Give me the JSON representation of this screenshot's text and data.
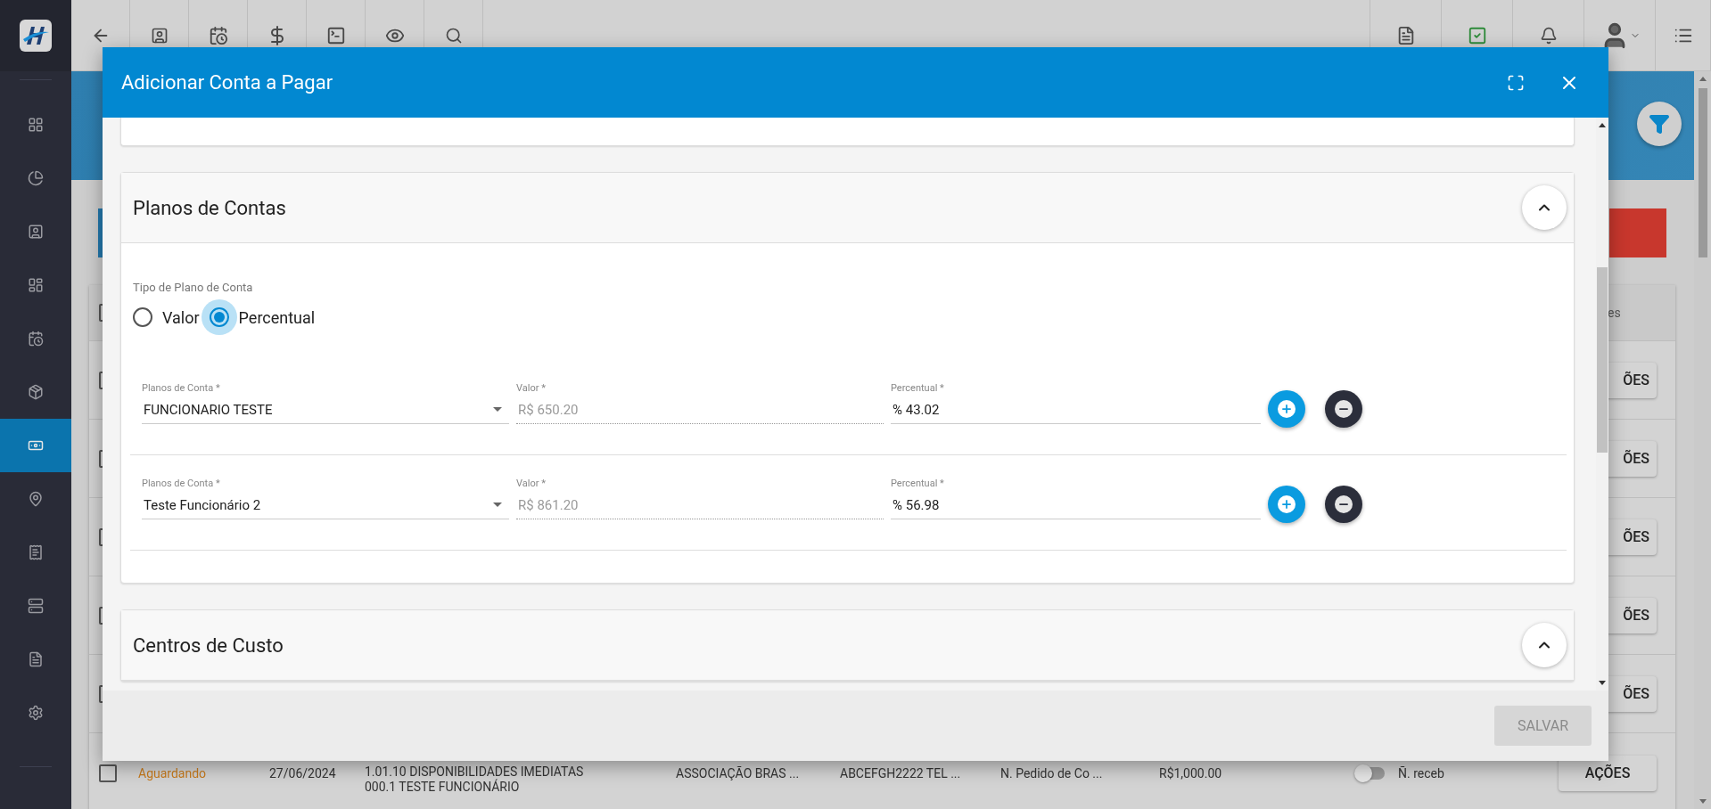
{
  "sidebar": {
    "items": [
      {
        "selected": false
      },
      {
        "selected": false
      },
      {
        "selected": false
      },
      {
        "selected": false
      },
      {
        "selected": false
      },
      {
        "selected": false
      },
      {
        "selected": true
      },
      {
        "selected": false
      },
      {
        "selected": false
      },
      {
        "selected": false
      },
      {
        "selected": false
      },
      {
        "selected": false
      }
    ]
  },
  "background_table": {
    "header_fragment": "es",
    "header_checked": false,
    "rows": [
      {
        "checked": false,
        "action": "ÕES"
      },
      {
        "checked": false,
        "action": "ÕES"
      },
      {
        "checked": false,
        "action": "ÕES"
      },
      {
        "checked": false,
        "action": "ÕES"
      },
      {
        "checked": false,
        "action": "ÕES"
      }
    ],
    "last_row": {
      "checked": false,
      "status": "Aguardando",
      "date": "27/06/2024",
      "description": [
        "1.01.10 DISPONIBILIDADES IMEDIATAS",
        "000.1 TESTE FUNCIONÁRIO"
      ],
      "supplier": "ASSOCIAÇÃO BRAS ...",
      "document": "ABCEFGH2222 TEL ...",
      "order": "N. Pedido de Co ...",
      "amount": "R$1,000.00",
      "received": false,
      "received_label": "Ñ. receb",
      "action": "AÇÕES"
    }
  },
  "modal": {
    "title": "Adicionar Conta a Pagar",
    "sections": [
      {
        "title": "Planos de Contas",
        "expanded": true,
        "type_label": "Tipo de Plano de Conta",
        "options": [
          {
            "label": "Valor",
            "selected": false
          },
          {
            "label": "Percentual",
            "selected": true
          }
        ],
        "rows": [
          {
            "account_label": "Planos de Conta *",
            "account": "FUNCIONARIO TESTE",
            "value_label": "Valor *",
            "value": "R$ 650.20",
            "percent_label": "Percentual *",
            "percent": "% 43.02"
          },
          {
            "account_label": "Planos de Conta *",
            "account": "Teste Funcionário 2",
            "value_label": "Valor *",
            "value": "R$ 861.20",
            "percent_label": "Percentual *",
            "percent": "% 56.98"
          }
        ]
      },
      {
        "title": "Centros de Custo",
        "expanded": true
      }
    ],
    "save_button": {
      "label": "SALVAR",
      "disabled": true
    }
  }
}
